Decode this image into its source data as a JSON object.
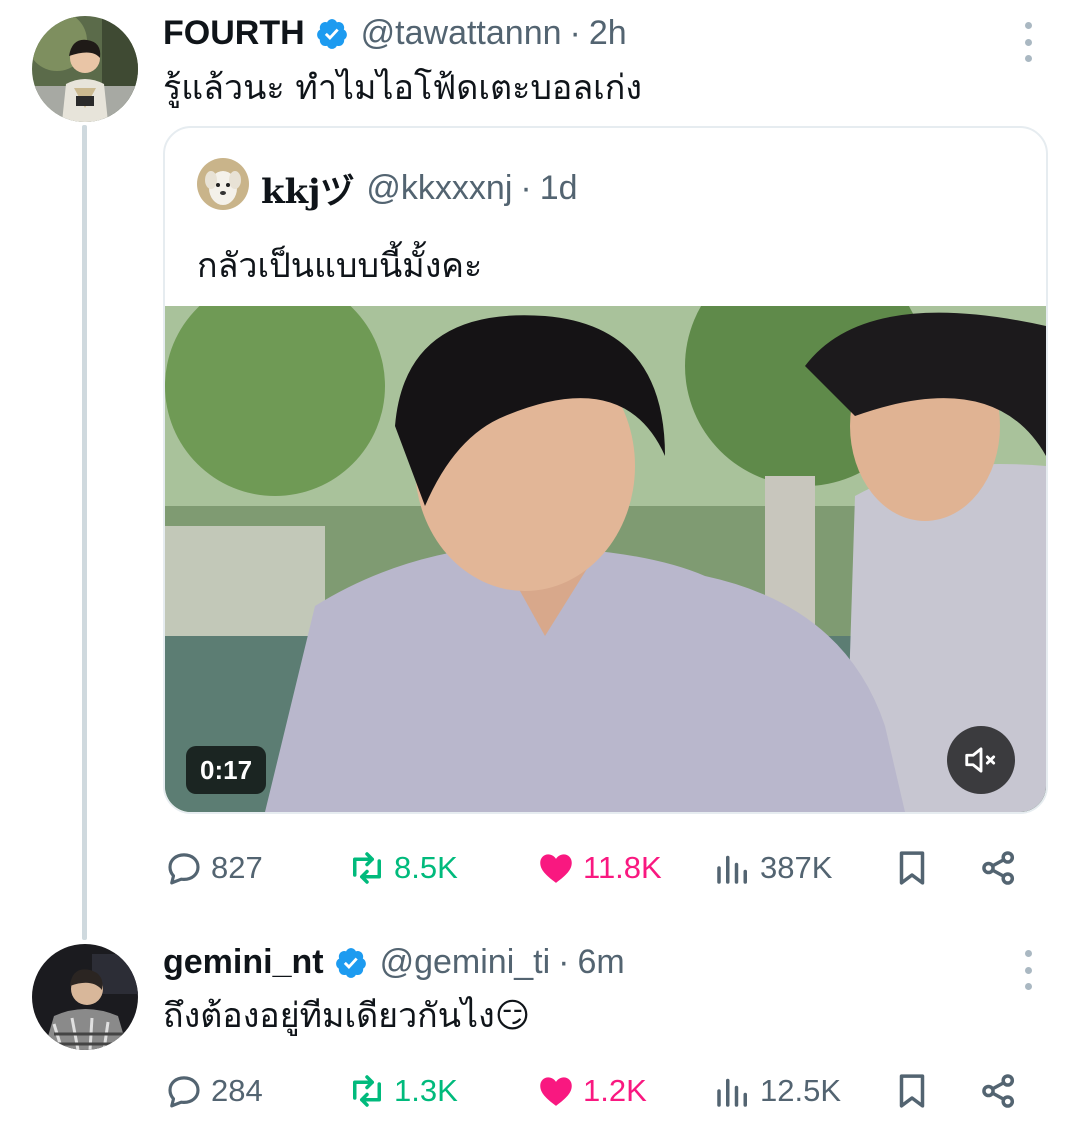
{
  "tweets": [
    {
      "display_name": "FOURTH",
      "handle": "@tawattannn",
      "separator": "·",
      "time": "2h",
      "text": "รู้แล้วนะ ทำไมไอโฟ้ดเตะบอลเก่ง",
      "quote": {
        "display_name": "kkjヅ",
        "handle": "@kkxxxnj",
        "separator": "·",
        "time": "1d",
        "text": "กลัวเป็นแบบนี้มั้งคะ",
        "video_duration": "0:17"
      },
      "stats": {
        "replies": "827",
        "retweets": "8.5K",
        "likes": "11.8K",
        "views": "387K"
      }
    },
    {
      "display_name": "gemini_nt",
      "handle": "@gemini_ti",
      "separator": "·",
      "time": "6m",
      "text": "ถึงต้องอยู่ทีมเดียวกันไง😏",
      "stats": {
        "replies": "284",
        "retweets": "1.3K",
        "likes": "1.2K",
        "views": "12.5K"
      }
    }
  ],
  "colors": {
    "verified": "#1d9bf0",
    "retweet_active": "#00ba7c",
    "like_active": "#f91880",
    "secondary_text": "#536471"
  },
  "icons": [
    "verified-badge-icon",
    "more-icon",
    "reply-icon",
    "retweet-icon",
    "like-icon",
    "views-icon",
    "bookmark-icon",
    "share-icon",
    "mute-icon"
  ]
}
